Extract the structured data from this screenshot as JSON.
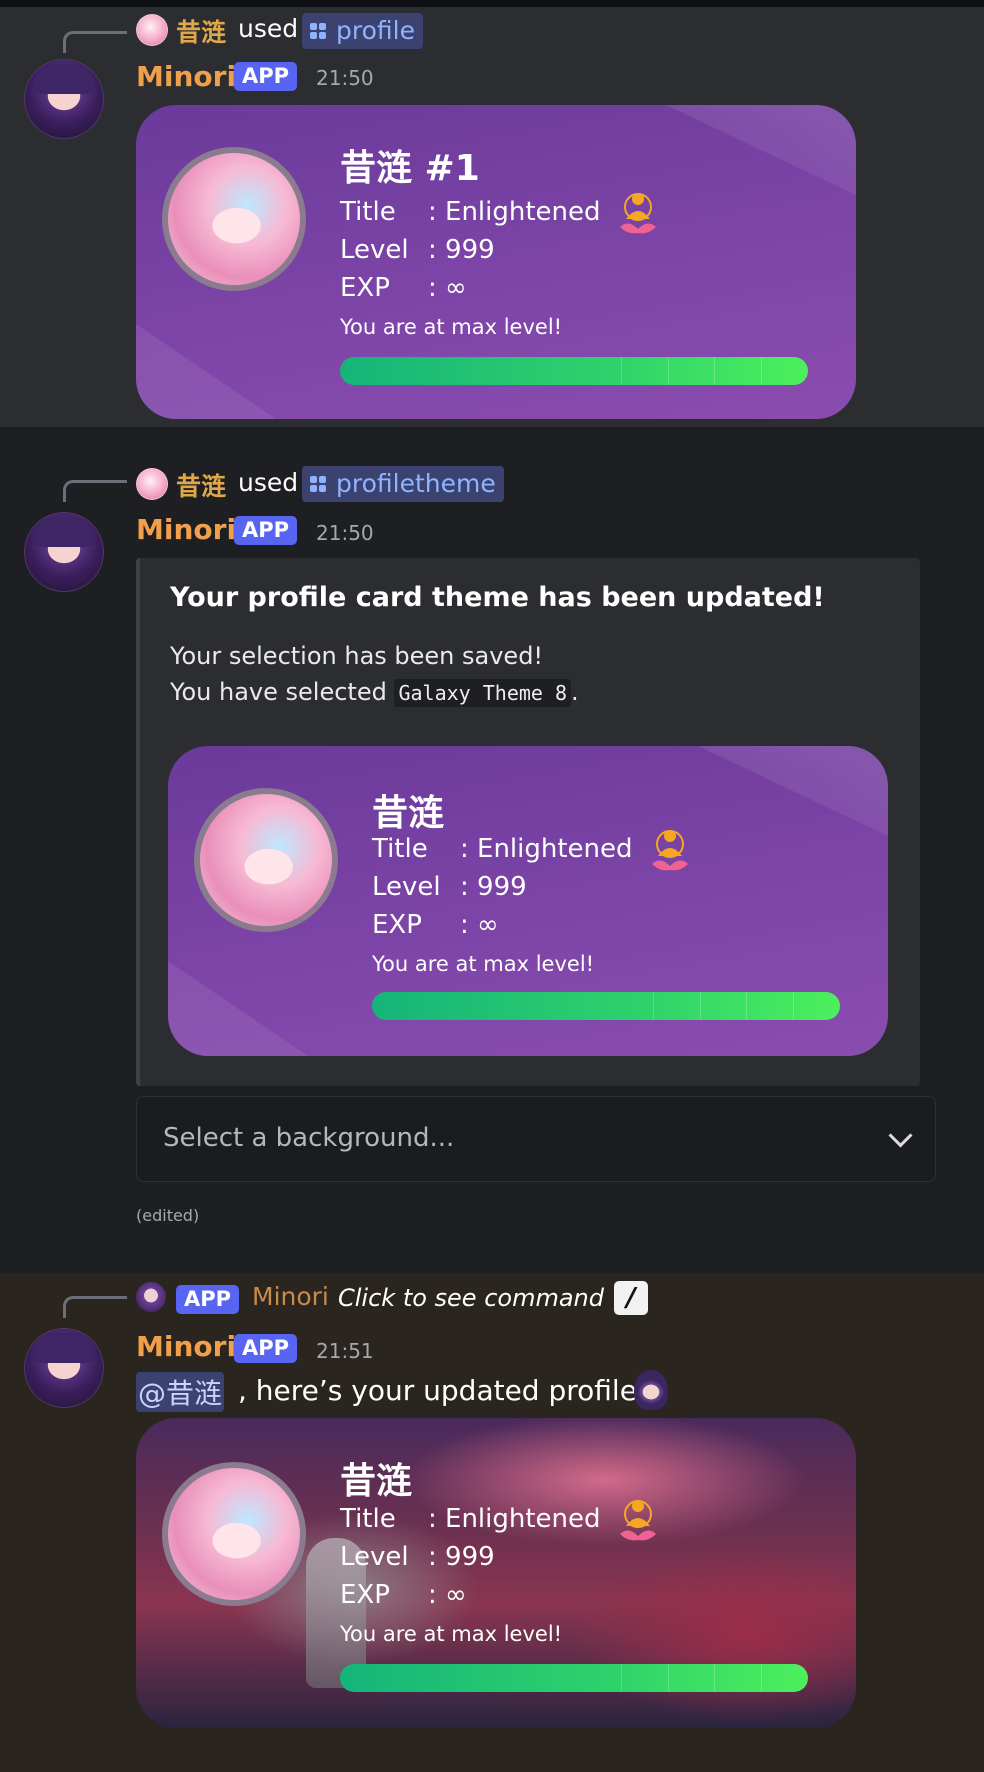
{
  "user": {
    "name": "昔涟",
    "mention": "@昔涟"
  },
  "bot": {
    "name": "Minori",
    "badge": "APP"
  },
  "messages": [
    {
      "reply": {
        "user": "昔涟",
        "used": "used",
        "command": "profile"
      },
      "time": "21:50",
      "card": {
        "name": "昔涟 #1",
        "title_label": "Title",
        "title_value": ": Enlightened",
        "level_label": "Level",
        "level_value": ": 999",
        "exp_label": "EXP",
        "exp_value": ": ∞",
        "note": "You are at max level!",
        "progress": 1.0
      }
    },
    {
      "reply": {
        "user": "昔涟",
        "used": "used",
        "command": "profiletheme"
      },
      "time": "21:50",
      "embed": {
        "title": "Your profile card theme has been updated!",
        "line1": "Your selection has been saved!",
        "line2_prefix": "You have selected ",
        "theme": "Galaxy Theme 8",
        "line2_suffix": "."
      },
      "card": {
        "name": "昔涟",
        "title_label": "Title",
        "title_value": ": Enlightened",
        "level_label": "Level",
        "level_value": ": 999",
        "exp_label": "EXP",
        "exp_value": ": ∞",
        "note": "You are at max level!",
        "progress": 1.0
      },
      "select": {
        "placeholder": "Select a background..."
      },
      "edited": "(edited)"
    },
    {
      "reply": {
        "badge": "APP",
        "user": "Minori",
        "text": "Click to see command",
        "slash": "/"
      },
      "time": "21:51",
      "text": ", here’s your updated profile!",
      "card": {
        "name": "昔涟",
        "title_label": "Title",
        "title_value": ": Enlightened",
        "level_label": "Level",
        "level_value": ": 999",
        "exp_label": "EXP",
        "exp_value": ": ∞",
        "note": "You are at max level!",
        "progress": 1.0
      }
    }
  ],
  "icons": {
    "command": "command-grid-icon",
    "lotus": "lotus-meditation-icon",
    "chevron": "chevron-down-icon",
    "slash": "slash-command-icon"
  },
  "colors": {
    "author": "#f0a04b",
    "app_badge": "#5865f2",
    "command_chip": "#3c4270",
    "progress_start": "#15b47a",
    "progress_end": "#4cf05c",
    "card_purple": "#7d45a7"
  }
}
